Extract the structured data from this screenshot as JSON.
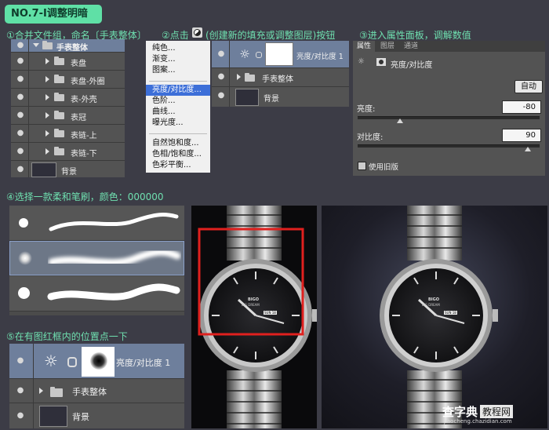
{
  "title": "NO.7-Ⅰ调整明暗",
  "steps": {
    "s1": "①合并文件组，命名〔手表整体〕",
    "s2a": "②点击",
    "s2b": "(创建新的填充或调整图层)按钮",
    "s3": "③进入属性面板，调解数值",
    "s4": "④选择一款柔和笔刷，颜色：000000",
    "s5": "⑤在有图红框内的位置点一下"
  },
  "layers1": {
    "group": "手表整体",
    "children": [
      "表盘",
      "表盘-外圈",
      "表-外壳",
      "表冠",
      "表链-上",
      "表链-下"
    ],
    "background": "背景"
  },
  "menu": {
    "items": [
      "纯色...",
      "渐变...",
      "图案...",
      "亮度/对比度...",
      "色阶...",
      "曲线...",
      "曝光度...",
      "自然饱和度...",
      "色相/饱和度...",
      "色彩平衡..."
    ],
    "selected_index": 3
  },
  "layers2": {
    "adjust": "亮度/对比度 1",
    "group": "手表整体",
    "background": "背景"
  },
  "properties": {
    "tabs": [
      "属性",
      "图层",
      "通道"
    ],
    "header": "亮度/对比度",
    "auto_button": "自动",
    "brightness_label": "亮度:",
    "brightness_value": "-80",
    "brightness_level": -80,
    "contrast_label": "对比度:",
    "contrast_value": "90",
    "contrast_level": 90,
    "legacy_label": "使用旧版"
  },
  "layers3": {
    "adjust": "亮度/对比度 1",
    "group": "手表整体",
    "background": "背景"
  },
  "watch": {
    "brand": "BIGO",
    "sub": "BIG DREAM",
    "date": "SUN 18"
  },
  "watermark": {
    "line1": "查字典",
    "line2": "教程网",
    "url": "jiaocheng.chazidian.com"
  },
  "colors": {
    "accent": "#5fe0a6",
    "step_text": "#6fe0b0",
    "highlight": "#3d6fd8",
    "red_box": "#e0201e"
  }
}
